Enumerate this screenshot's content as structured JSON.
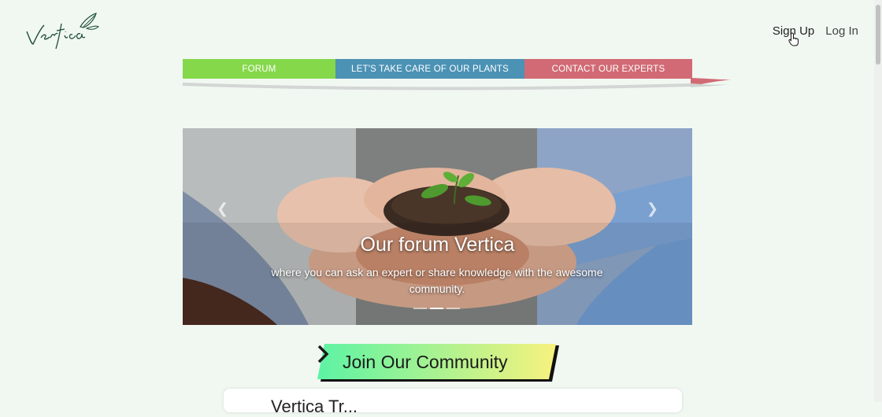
{
  "header": {
    "logo_text": "Vertica",
    "sign_up_label": "Sign Up",
    "log_in_label": "Log In"
  },
  "nav": {
    "tabs": [
      {
        "label": "FORUM",
        "color": "#85d84a"
      },
      {
        "label": "LET'S TAKE CARE OF OUR PLANTS",
        "color": "#4b92b5"
      },
      {
        "label": "CONTACT OUR EXPERTS",
        "color": "#d16a74"
      }
    ]
  },
  "carousel": {
    "title": "Our forum Vertica",
    "subtitle": "where you can ask an expert or share knowledge with the awesome community.",
    "prev_icon": "chevron-left-icon",
    "next_icon": "chevron-right-icon",
    "slide_count": 3,
    "active_slide": 2
  },
  "cta": {
    "join_label": "Join Our Community",
    "gradient": [
      "#5cf3a4",
      "#f7f27e"
    ]
  },
  "search_card": {
    "title_partial": "Vertica Tr..."
  },
  "colors": {
    "background": "#f1f8f1",
    "logo": "#1f4d3a"
  }
}
